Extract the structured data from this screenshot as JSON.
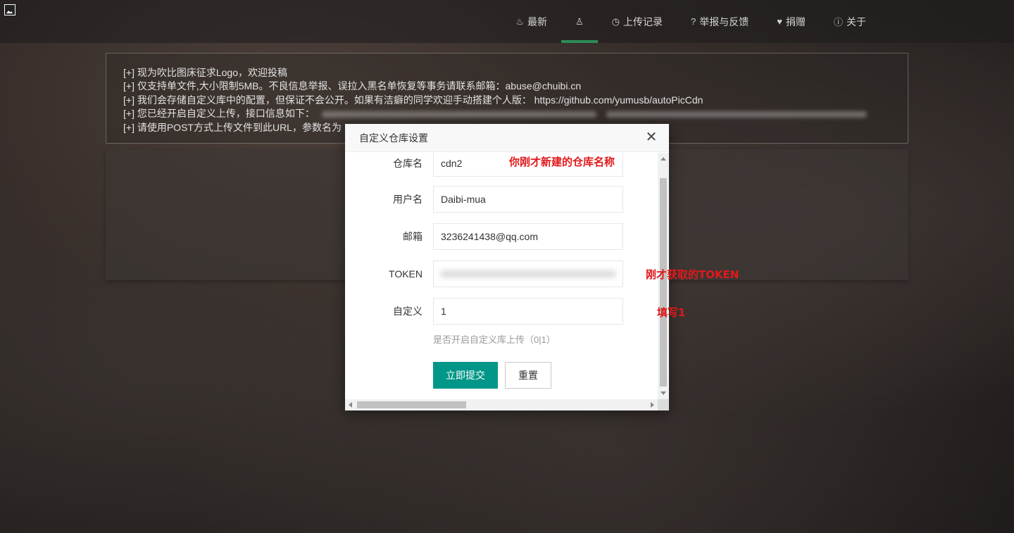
{
  "nav": {
    "items": [
      {
        "icon": "fire-icon",
        "glyph": "♨",
        "label": "最新"
      },
      {
        "icon": "user-icon",
        "glyph": "♙",
        "label": ""
      },
      {
        "icon": "clock-icon",
        "glyph": "◷",
        "label": "上传记录"
      },
      {
        "icon": "question-icon",
        "glyph": "?",
        "label": "举报与反馈"
      },
      {
        "icon": "heart-icon",
        "glyph": "♥",
        "label": "捐赠"
      },
      {
        "icon": "info-icon",
        "glyph": "ⓘ",
        "label": "关于"
      }
    ]
  },
  "notice": {
    "lines": [
      "[+] 现为吹比图床征求Logo，欢迎投稿",
      "[+] 仅支持单文件,大小限制5MB。不良信息举报、误拉入黑名单恢复等事务请联系邮箱：abuse@chuibi.cn",
      "[+] 我们会存储自定义库中的配置，但保证不会公开。如果有洁癖的同学欢迎手动搭建个人版： https://github.com/yumusb/autoPicCdn",
      "[+] 您已经开启自定义上传，接口信息如下：",
      "[+] 请使用POST方式上传文件到此URL，参数名为"
    ]
  },
  "modal": {
    "title": "自定义仓库设置",
    "close_glyph": "✕",
    "fields": {
      "repo": {
        "label": "仓库名",
        "value": "cdn2"
      },
      "username": {
        "label": "用户名",
        "value": "Daibi-mua"
      },
      "email": {
        "label": "邮箱",
        "value": "3236241438@qq.com"
      },
      "token": {
        "label": "TOKEN",
        "value": ""
      },
      "custom": {
        "label": "自定义",
        "value": "1"
      }
    },
    "hint": "是否开启自定义库上传（0|1）",
    "submit_label": "立即提交",
    "reset_label": "重置"
  },
  "annotations": {
    "repo_note": "你刚才新建的仓库名称",
    "token_note": "刚才获取的TOKEN",
    "custom_note": "填写1"
  },
  "colors": {
    "primary": "#009688",
    "nav_active": "#2e8b57",
    "annotation": "#e0191b"
  }
}
